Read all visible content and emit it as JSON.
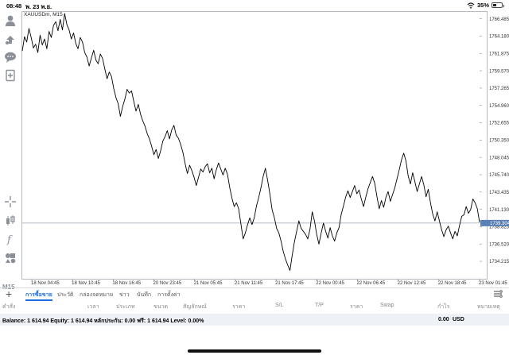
{
  "status_bar": {
    "time": "08:48",
    "date": "พ. 23 พ.ย.",
    "battery": "35%",
    "battery_level": 0.35
  },
  "chart": {
    "symbol": "XAUUSDm, M15",
    "current_price": "1739.304",
    "price_ticks": [
      "1766.485",
      "1764.180",
      "1761.875",
      "1759.570",
      "1757.265",
      "1754.960",
      "1752.655",
      "1750.350",
      "1748.045",
      "1745.740",
      "1743.435",
      "1741.130",
      "1738.825",
      "1736.520",
      "1734.215"
    ],
    "time_ticks": [
      "18 Nov 04:45",
      "18 Nov 10:45",
      "18 Nov 16:45",
      "20 Nov 23:45",
      "21 Nov 05:45",
      "21 Nov 11:45",
      "21 Nov 17:45",
      "22 Nov 00:45",
      "22 Nov 06:45",
      "22 Nov 12:45",
      "22 Nov 18:45",
      "23 Nov 01:45"
    ]
  },
  "chart_data": {
    "type": "line",
    "title": "XAUUSDm, M15",
    "ylim": [
      1732.0,
      1767.4
    ],
    "current_price": 1739.304,
    "values": [
      1762.2,
      1764.1,
      1763.4,
      1765.2,
      1764.0,
      1762.6,
      1763.1,
      1762.0,
      1764.3,
      1763.0,
      1763.8,
      1762.5,
      1764.8,
      1764.0,
      1765.6,
      1766.1,
      1764.9,
      1766.4,
      1765.0,
      1767.2,
      1765.7,
      1765.0,
      1763.8,
      1764.6,
      1763.2,
      1762.5,
      1764.0,
      1763.4,
      1762.0,
      1761.4,
      1760.2,
      1761.3,
      1762.3,
      1761.0,
      1760.5,
      1761.8,
      1761.2,
      1759.8,
      1758.5,
      1759.4,
      1758.8,
      1757.2,
      1756.0,
      1755.2,
      1753.5,
      1754.8,
      1755.8,
      1757.1,
      1756.6,
      1756.9,
      1755.5,
      1754.2,
      1755.1,
      1753.8,
      1752.9,
      1752.2,
      1751.2,
      1750.5,
      1749.5,
      1748.4,
      1749.1,
      1747.9,
      1748.9,
      1750.2,
      1750.8,
      1751.6,
      1750.5,
      1751.7,
      1752.3,
      1751.0,
      1750.6,
      1749.8,
      1748.7,
      1747.2,
      1745.9,
      1747.0,
      1746.3,
      1745.4,
      1744.3,
      1745.4,
      1746.5,
      1746.1,
      1746.8,
      1747.2,
      1746.0,
      1746.6,
      1745.2,
      1746.4,
      1747.3,
      1746.5,
      1745.7,
      1746.6,
      1745.8,
      1744.0,
      1742.6,
      1741.5,
      1742.0,
      1741.2,
      1739.2,
      1737.2,
      1738.0,
      1739.1,
      1740.0,
      1739.1,
      1740.0,
      1741.6,
      1742.7,
      1744.0,
      1745.5,
      1746.6,
      1745.0,
      1743.2,
      1741.1,
      1740.0,
      1738.6,
      1738.0,
      1736.9,
      1735.5,
      1734.5,
      1733.7,
      1733.0,
      1735.0,
      1736.8,
      1738.2,
      1739.6,
      1738.6,
      1738.2,
      1737.8,
      1737.2,
      1738.5,
      1740.8,
      1739.6,
      1737.8,
      1736.5,
      1738.0,
      1739.3,
      1738.2,
      1737.3,
      1738.7,
      1737.6,
      1736.9,
      1738.0,
      1738.7,
      1740.5,
      1741.6,
      1742.8,
      1743.6,
      1742.7,
      1743.5,
      1744.3,
      1743.2,
      1743.7,
      1742.5,
      1741.5,
      1742.8,
      1743.9,
      1744.7,
      1745.5,
      1744.6,
      1742.8,
      1741.2,
      1742.3,
      1741.4,
      1742.7,
      1743.5,
      1742.2,
      1743.1,
      1744.0,
      1745.2,
      1746.4,
      1747.7,
      1748.6,
      1747.6,
      1745.6,
      1744.5,
      1746.0,
      1744.8,
      1743.5,
      1744.5,
      1745.5,
      1744.4,
      1742.8,
      1743.8,
      1742.0,
      1740.5,
      1739.6,
      1740.8,
      1739.6,
      1738.4,
      1737.5,
      1738.4,
      1738.9,
      1738.0,
      1737.2,
      1738.2,
      1737.6,
      1739.0,
      1740.2,
      1740.4,
      1741.5,
      1740.6,
      1741.1,
      1742.5,
      1742.0,
      1741.2,
      1739.4
    ]
  },
  "tabs": {
    "items": [
      "การซื้อขาย",
      "ประวัติ",
      "กล่องจดหมาย",
      "ข่าว",
      "บันทึก",
      "การตั้งค่า"
    ],
    "active": 0
  },
  "table_header": [
    "คำสั่ง",
    "เวลา",
    "ประเภท",
    "ขนาด",
    "สัญลักษณ์",
    "ราคา",
    "S/L",
    "T/P",
    "ราคา",
    "Swap",
    "กำไร",
    "หมายเหตุ"
  ],
  "balance": {
    "text": "Balance: 1 614.94  Equity: 1 614.94  หลักประกัน: 0.00  ฟรี: 1 614.94  Level: 0.00%",
    "value": "0.00",
    "currency": "USD"
  },
  "toolbar": {
    "icons": [
      "account-icon",
      "trade-icon",
      "chat-icon",
      "new-order-icon",
      "crosshair-icon",
      "chart-type-icon",
      "indicator-icon",
      "objects-icon"
    ],
    "timeframe": "M15"
  },
  "colors": {
    "accent": "#1e6fd9",
    "price_line": "#000000",
    "grid": "#e6e8eb",
    "current_price_bg": "#5a7fb5"
  }
}
